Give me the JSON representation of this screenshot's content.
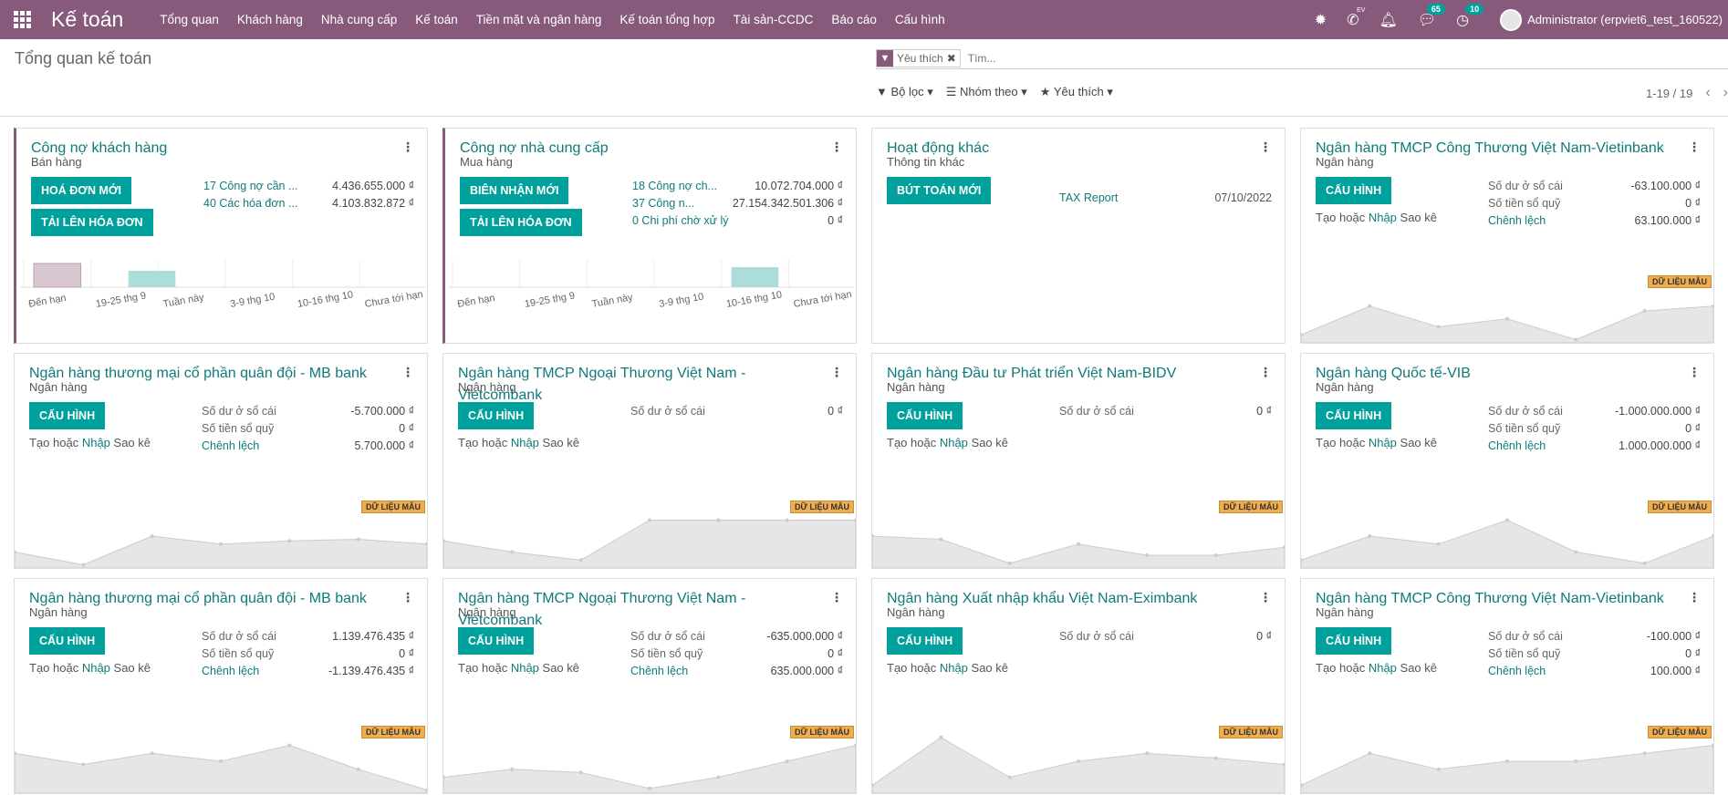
{
  "app": {
    "title": "Kế toán"
  },
  "menu": [
    "Tổng quan",
    "Khách hàng",
    "Nhà cung cấp",
    "Kế toán",
    "Tiền mặt và ngân hàng",
    "Kế toán tổng hợp",
    "Tài sản-CCDC",
    "Báo cáo",
    "Cấu hình"
  ],
  "systray": {
    "lang_code": "EV",
    "messages_count": "65",
    "activities_count": "10",
    "user": "Administrator (erpviet6_test_160522)"
  },
  "control_panel": {
    "breadcrumb": "Tổng quan kế toán",
    "search_facet": "Yêu thích",
    "search_placeholder": "Tìm...",
    "filters": [
      "Bộ lọc",
      "Nhóm theo",
      "Yêu thích"
    ],
    "pager": "1-19 / 19"
  },
  "sample_label": "DỮ LIỆU MẪU",
  "cards": [
    {
      "title": "Công nợ khách hàng",
      "subtitle": "Bán hàng",
      "buttons": [
        "HOÁ ĐƠN MỚI",
        "TẢI LÊN HÓA ĐƠN"
      ],
      "rows": [
        {
          "label": "17 Công nợ cần ...",
          "value": "4.436.655.000 ₫"
        },
        {
          "label": "40 Các hóa đơn ...",
          "value": "4.103.832.872 ₫"
        }
      ],
      "chart": {
        "type": "bar",
        "categories": [
          "Đến hạn",
          "19-25 thg 9",
          "Tuần này",
          "3-9 thg 10",
          "10-16 thg 10",
          "Chưa tới hạn"
        ],
        "values": [
          26,
          18,
          0,
          0,
          0,
          0
        ]
      }
    },
    {
      "title": "Công nợ nhà cung cấp",
      "subtitle": "Mua hàng",
      "buttons": [
        "BIÊN NHẬN MỚI",
        "TẢI LÊN HÓA ĐƠN"
      ],
      "rows": [
        {
          "label": "18 Công nợ ch...",
          "value": "10.072.704.000 ₫"
        },
        {
          "label": "37 Công n...",
          "value": "27.154.342.501.306 ₫"
        },
        {
          "label": "0 Chi phí chờ xử lý",
          "value": "0 ₫"
        }
      ],
      "chart": {
        "type": "bar",
        "categories": [
          "Đến hạn",
          "19-25 thg 9",
          "Tuần này",
          "3-9 thg 10",
          "10-16 thg 10",
          "Chưa tới hạn"
        ],
        "values": [
          0,
          0,
          0,
          0,
          22,
          0
        ]
      }
    },
    {
      "title": "Hoạt động khác",
      "subtitle": "Thông tin khác",
      "buttons": [
        "BÚT TOÁN MỚI"
      ],
      "tax": {
        "label": "TAX Report",
        "date": "07/10/2022"
      }
    },
    {
      "title": "Ngân hàng TMCP Công Thương Việt Nam-Vietinbank",
      "subtitle": "Ngân hàng",
      "buttons": [
        "CẤU HÌNH"
      ],
      "link": {
        "a": "Tạo hoặc",
        "b": "Nhập",
        "c": "Sao kê"
      },
      "rows": [
        {
          "label": "Số dư ở sổ cái",
          "value": "-63.100.000 ₫"
        },
        {
          "label": "Số tiền sổ quỹ",
          "value": "0 ₫"
        },
        {
          "label": "Chênh lệch",
          "value": "63.100.000 ₫",
          "link": true
        }
      ],
      "line": [
        10,
        46,
        20,
        30,
        4,
        40,
        46
      ]
    },
    {
      "title": "Ngân hàng thương mại cổ phần quân đội - MB bank",
      "subtitle": "Ngân hàng",
      "buttons": [
        "CẤU HÌNH"
      ],
      "link": {
        "a": "Tạo hoặc",
        "b": "Nhập",
        "c": "Sao kê"
      },
      "rows": [
        {
          "label": "Số dư ở sổ cái",
          "value": "-5.700.000 ₫"
        },
        {
          "label": "Số tiền sổ quỹ",
          "value": "0 ₫"
        },
        {
          "label": "Chênh lệch",
          "value": "5.700.000 ₫",
          "link": true
        }
      ],
      "line": [
        20,
        4,
        40,
        30,
        34,
        36,
        30
      ]
    },
    {
      "title": "Ngân hàng TMCP Ngoại Thương Việt Nam - Vietcombank",
      "subtitle": "Ngân hàng",
      "buttons": [
        "CẤU HÌNH"
      ],
      "link": {
        "a": "Tạo hoặc",
        "b": "Nhập",
        "c": "Sao kê"
      },
      "rows": [
        {
          "label": "Số dư ở sổ cái",
          "value": "0 ₫"
        }
      ],
      "line": [
        34,
        20,
        10,
        60,
        60,
        60,
        60
      ]
    },
    {
      "title": "Ngân hàng Đầu tư Phát triển Việt Nam-BIDV",
      "subtitle": "Ngân hàng",
      "buttons": [
        "CẤU HÌNH"
      ],
      "link": {
        "a": "Tạo hoặc",
        "b": "Nhập",
        "c": "Sao kê"
      },
      "rows": [
        {
          "label": "Số dư ở sổ cái",
          "value": "0 ₫"
        }
      ],
      "line": [
        40,
        36,
        6,
        30,
        16,
        16,
        26
      ]
    },
    {
      "title": "Ngân hàng Quốc tế-VIB",
      "subtitle": "Ngân hàng",
      "buttons": [
        "CẤU HÌNH"
      ],
      "link": {
        "a": "Tạo hoặc",
        "b": "Nhập",
        "c": "Sao kê"
      },
      "rows": [
        {
          "label": "Số dư ở sổ cái",
          "value": "-1.000.000.000 ₫"
        },
        {
          "label": "Số tiền sổ quỹ",
          "value": "0 ₫"
        },
        {
          "label": "Chênh lệch",
          "value": "1.000.000.000 ₫",
          "link": true
        }
      ],
      "line": [
        10,
        40,
        30,
        60,
        20,
        6,
        40
      ]
    },
    {
      "title": "Ngân hàng thương mại cổ phần quân đội - MB bank",
      "subtitle": "Ngân hàng",
      "buttons": [
        "CẤU HÌNH"
      ],
      "link": {
        "a": "Tạo hoặc",
        "b": "Nhập",
        "c": "Sao kê"
      },
      "rows": [
        {
          "label": "Số dư ở sổ cái",
          "value": "1.139.476.435 ₫"
        },
        {
          "label": "Số tiền sổ quỹ",
          "value": "0 ₫"
        },
        {
          "label": "Chênh lệch",
          "value": "-1.139.476.435 ₫",
          "link": true
        }
      ],
      "line": [
        50,
        36,
        50,
        40,
        60,
        30,
        4
      ]
    },
    {
      "title": "Ngân hàng TMCP Ngoại Thương Việt Nam - Vietcombank",
      "subtitle": "Ngân hàng",
      "buttons": [
        "CẤU HÌNH"
      ],
      "link": {
        "a": "Tạo hoặc",
        "b": "Nhập",
        "c": "Sao kê"
      },
      "rows": [
        {
          "label": "Số dư ở sổ cái",
          "value": "-635.000.000 ₫"
        },
        {
          "label": "Số tiền sổ quỹ",
          "value": "0 ₫"
        },
        {
          "label": "Chênh lệch",
          "value": "635.000.000 ₫",
          "link": true
        }
      ],
      "line": [
        20,
        30,
        26,
        6,
        20,
        40,
        60
      ]
    },
    {
      "title": "Ngân hàng Xuất nhập khẩu Việt Nam-Eximbank",
      "subtitle": "Ngân hàng",
      "buttons": [
        "CẤU HÌNH"
      ],
      "link": {
        "a": "Tạo hoặc",
        "b": "Nhập",
        "c": "Sao kê"
      },
      "rows": [
        {
          "label": "Số dư ở sổ cái",
          "value": "0 ₫"
        }
      ],
      "line": [
        10,
        70,
        20,
        40,
        50,
        44,
        36
      ]
    },
    {
      "title": "Ngân hàng TMCP Công Thương Việt Nam-Vietinbank",
      "subtitle": "Ngân hàng",
      "buttons": [
        "CẤU HÌNH"
      ],
      "link": {
        "a": "Tạo hoặc",
        "b": "Nhập",
        "c": "Sao kê"
      },
      "rows": [
        {
          "label": "Số dư ở sổ cái",
          "value": "-100.000 ₫"
        },
        {
          "label": "Số tiền sổ quỹ",
          "value": "0 ₫"
        },
        {
          "label": "Chênh lệch",
          "value": "100.000 ₫",
          "link": true
        }
      ],
      "line": [
        10,
        50,
        30,
        40,
        40,
        50,
        60
      ]
    }
  ]
}
